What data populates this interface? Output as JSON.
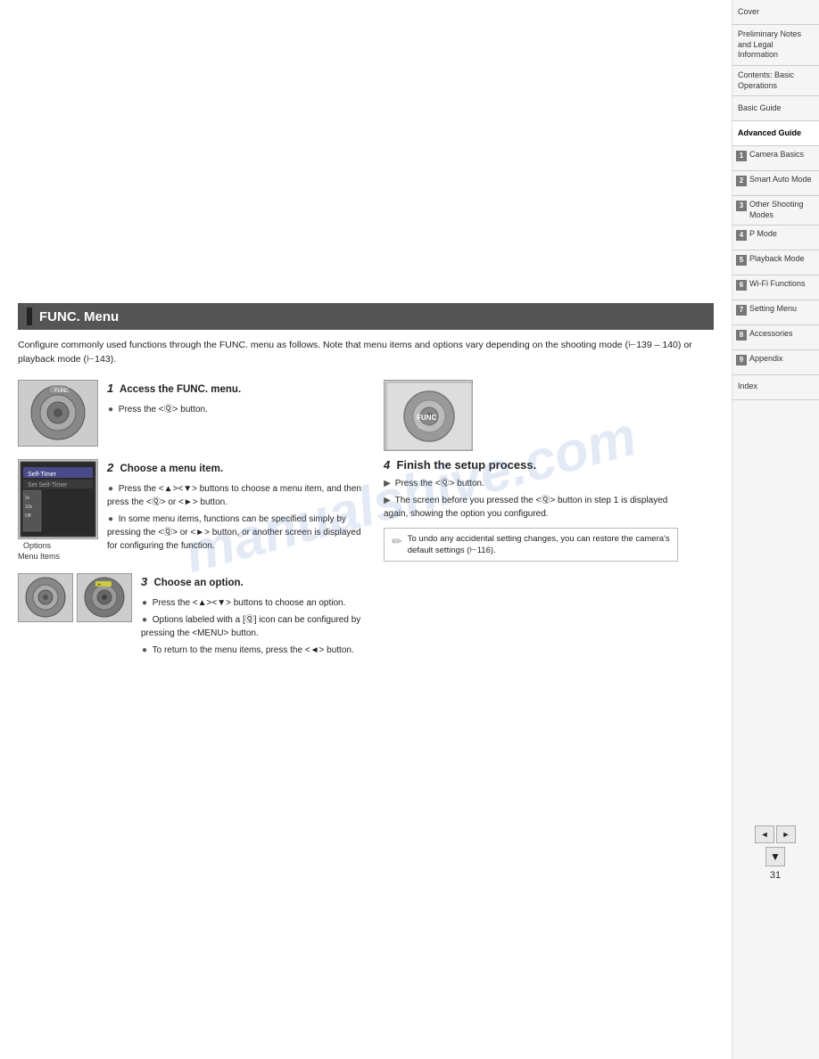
{
  "page": {
    "number": "31",
    "watermark": "manualshive.com"
  },
  "section": {
    "title": "FUNC. Menu",
    "intro": "Configure commonly used functions through the FUNC. menu as follows. Note that menu items and options vary depending on the shooting mode (⊢139 – 140) or playback mode (⊢143)."
  },
  "steps": [
    {
      "number": "1",
      "title": "Access the FUNC. menu.",
      "bullets": [
        "Press the <Ⓠ> button."
      ]
    },
    {
      "number": "2",
      "title": "Choose a menu item.",
      "bullets": [
        "Press the <▲><▼> buttons to choose a menu item, and then press the <Ⓠ> or <►> button.",
        "In some menu items, functions can be specified simply by pressing the <Ⓠ> or <►> button, or another screen is displayed for configuring the function."
      ],
      "labels": {
        "options": "Options",
        "menu_items": "Menu Items"
      }
    },
    {
      "number": "3",
      "title": "Choose an option.",
      "bullets": [
        "Press the <▲><▼> buttons to choose an option.",
        "Options labeled with a [Ⓠ] icon can be configured by pressing the <MENU> button.",
        "To return to the menu items, press the <◄> button."
      ]
    },
    {
      "number": "4",
      "title": "Finish the setup process.",
      "bullets": [
        "Press the <Ⓠ> button.",
        "The screen before you pressed the <Ⓠ> button in step 1 is displayed again, showing the option you configured."
      ]
    }
  ],
  "note": {
    "text": "To undo any accidental setting changes, you can restore the camera's default settings (⊢116)."
  },
  "sidebar": {
    "items": [
      {
        "label": "Cover",
        "numbered": false,
        "active": false
      },
      {
        "label": "Preliminary Notes and Legal Information",
        "numbered": false,
        "active": false
      },
      {
        "label": "Contents: Basic Operations",
        "numbered": false,
        "active": false
      },
      {
        "label": "Basic Guide",
        "numbered": false,
        "active": false
      },
      {
        "label": "Advanced Guide",
        "numbered": false,
        "active": true
      },
      {
        "label": "Camera Basics",
        "num": "1",
        "numbered": true,
        "active": false
      },
      {
        "label": "Smart Auto Mode",
        "num": "2",
        "numbered": true,
        "active": false
      },
      {
        "label": "Other Shooting Modes",
        "num": "3",
        "numbered": true,
        "active": false
      },
      {
        "label": "P Mode",
        "num": "4",
        "numbered": true,
        "active": false
      },
      {
        "label": "Playback Mode",
        "num": "5",
        "numbered": true,
        "active": false
      },
      {
        "label": "Wi-Fi Functions",
        "num": "6",
        "numbered": true,
        "active": false
      },
      {
        "label": "Setting Menu",
        "num": "7",
        "numbered": true,
        "active": false
      },
      {
        "label": "Accessories",
        "num": "8",
        "numbered": true,
        "active": false
      },
      {
        "label": "Appendix",
        "num": "9",
        "numbered": true,
        "active": false
      },
      {
        "label": "Index",
        "numbered": false,
        "active": false
      }
    ]
  },
  "nav": {
    "prev": "◄",
    "next": "►",
    "bookmark": "▼"
  }
}
